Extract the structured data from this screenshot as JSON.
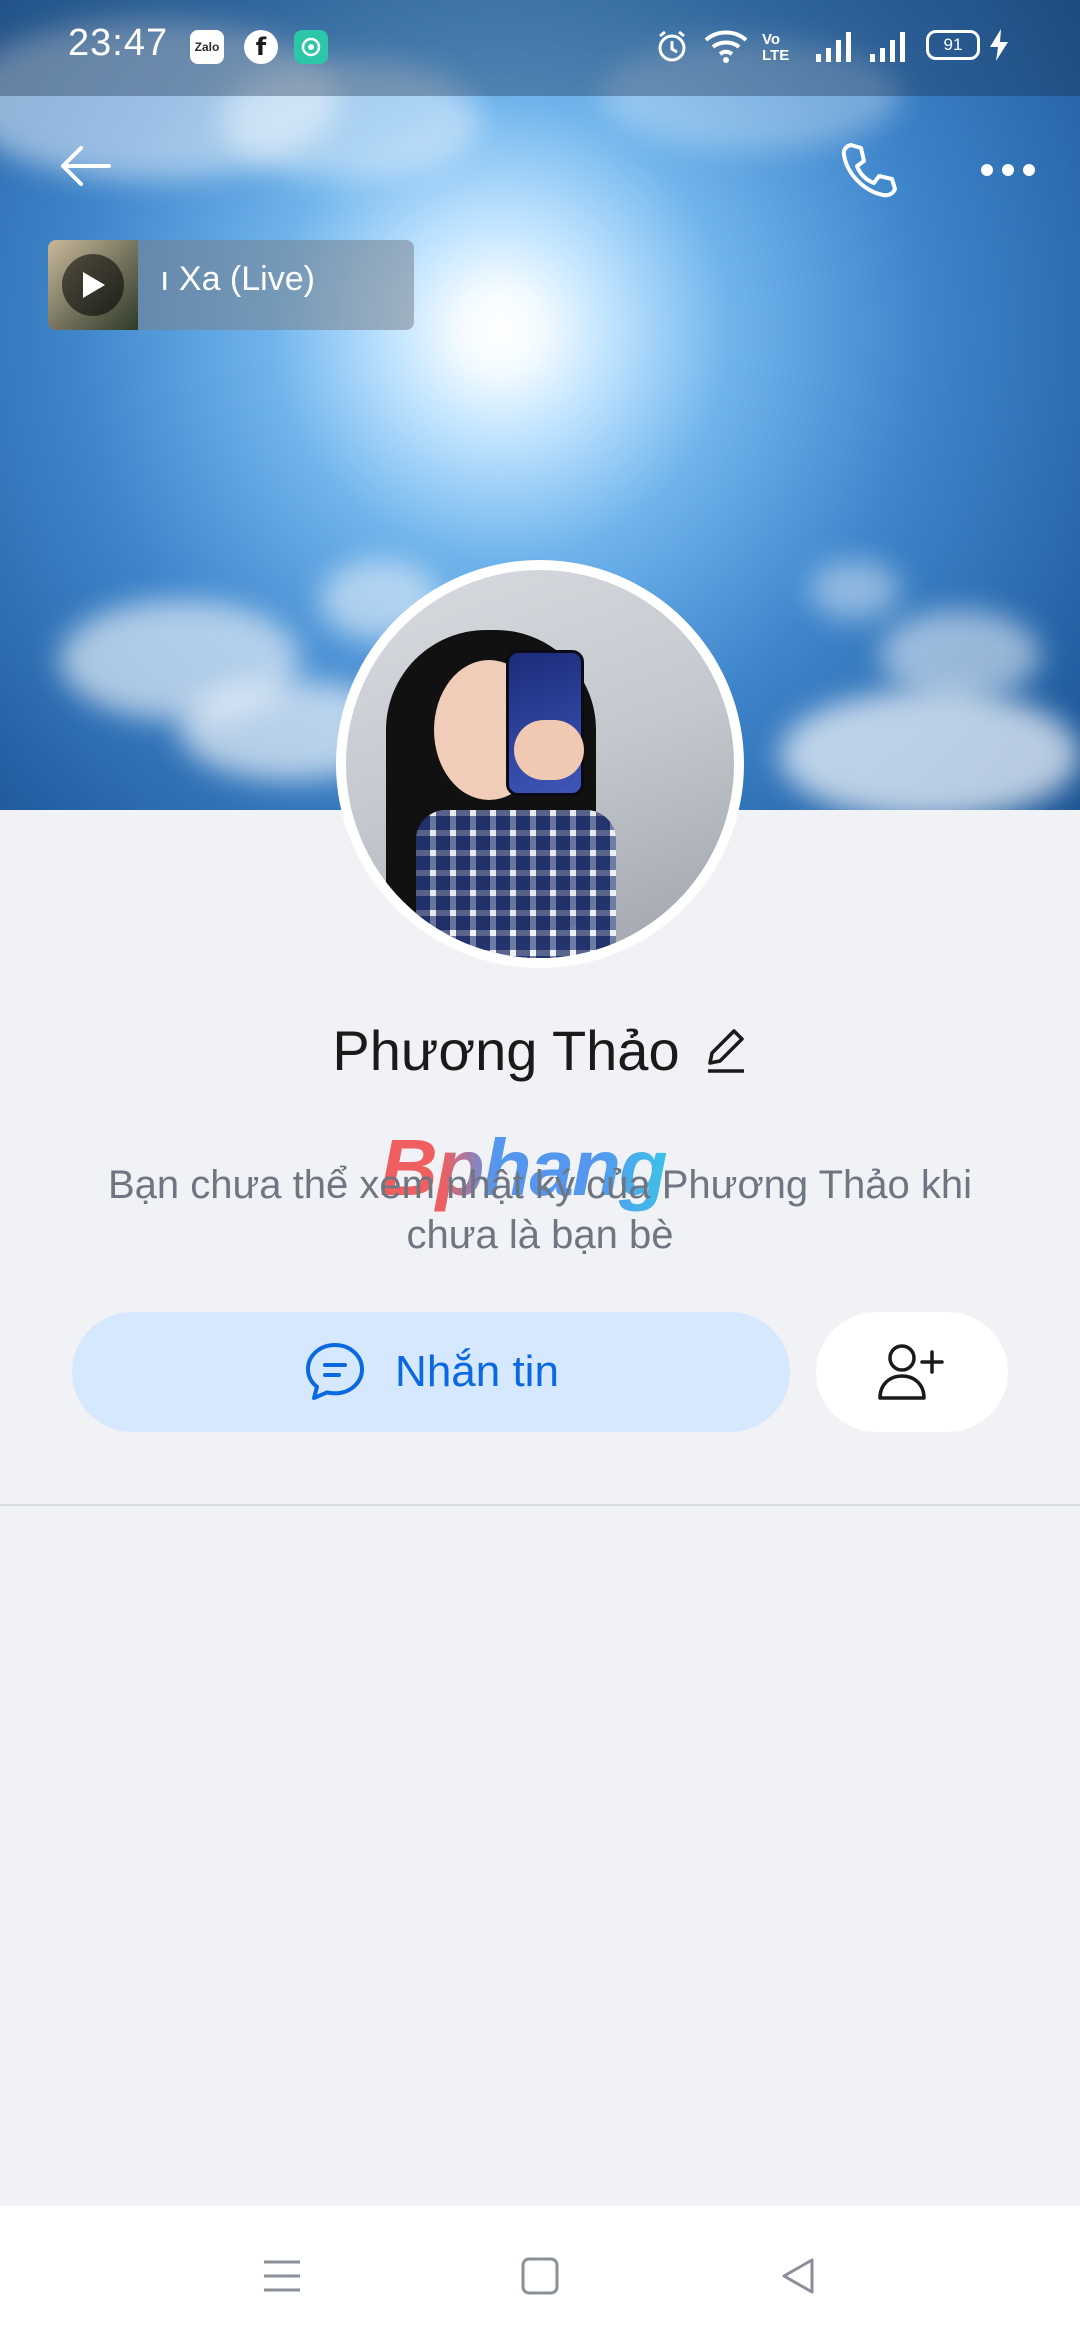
{
  "status_bar": {
    "time": "23:47",
    "apps": [
      {
        "name": "zalo-icon",
        "label": "Zalo"
      },
      {
        "name": "facebook-icon",
        "label": "f"
      },
      {
        "name": "messenger-app-icon",
        "label": ""
      }
    ],
    "volte": "Vo LTE",
    "battery": "91"
  },
  "header": {
    "back_icon": "back-arrow-icon",
    "call_icon": "phone-icon",
    "more_icon": "more-dots-icon"
  },
  "music": {
    "title": "ı Xa (Live)"
  },
  "profile": {
    "name": "Phương Thảo",
    "info": "Bạn chưa thể xem nhật ký của Phương Thảo khi chưa là bạn bè",
    "watermark": "Bphang"
  },
  "actions": {
    "message_label": "Nhắn tin",
    "add_friend_icon": "add-friend-icon"
  },
  "colors": {
    "accent": "#0a68e0",
    "message_bg": "#d6e8fd",
    "page_bg": "#f0f2f5"
  }
}
